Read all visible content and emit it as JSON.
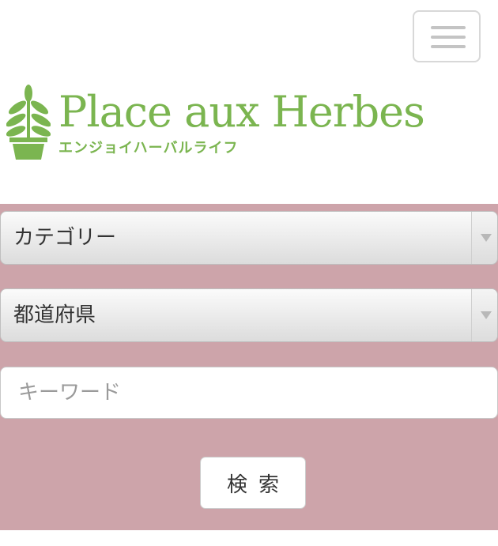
{
  "header": {
    "menu_icon": "hamburger-icon",
    "logo": {
      "icon": "potted-herb-icon",
      "title": "Place aux Herbes",
      "subtitle": "エンジョイハーバルライフ",
      "color": "#7bb550"
    }
  },
  "search": {
    "panel_color": "#cda4aa",
    "category_select": {
      "selected": "カテゴリー"
    },
    "prefecture_select": {
      "selected": "都道府県"
    },
    "keyword_input": {
      "placeholder": "キーワード",
      "value": ""
    },
    "submit_label": "検索",
    "dropdown_icon": "triangle-down-icon"
  }
}
